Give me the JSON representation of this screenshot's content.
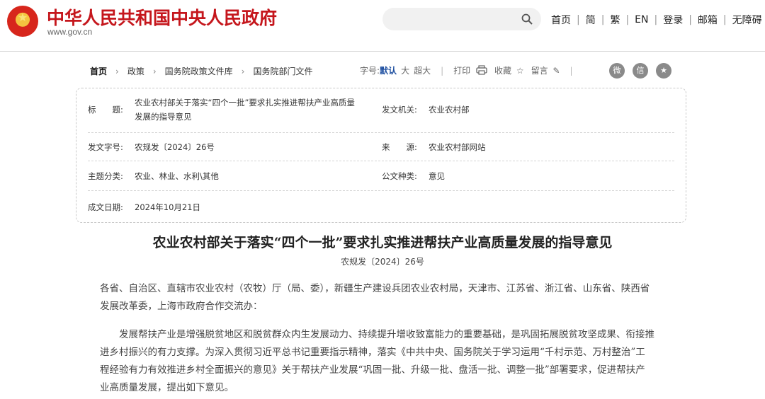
{
  "header": {
    "site_title": "中华人民共和国中央人民政府",
    "site_url": "www.gov.cn",
    "search_placeholder": "",
    "nav": [
      "首页",
      "简",
      "繁",
      "EN",
      "登录",
      "邮箱",
      "无障碍"
    ]
  },
  "breadcrumb": [
    "首页",
    "政策",
    "国务院政策文件库",
    "国务院部门文件"
  ],
  "toolbar": {
    "font_label": "字号:",
    "font_default": "默认",
    "font_large": "大",
    "font_xlarge": "超大",
    "print": "打印",
    "favorite": "收藏",
    "comment": "留言"
  },
  "meta": {
    "title_key": "标　　题:",
    "title_val_1": "农业农村部关于落实“四个一批”要求扎实推进帮扶产业高质量",
    "title_val_2": "发展的指导意见",
    "issuer_key": "发文机关:",
    "issuer_val": "农业农村部",
    "docno_key": "发文字号:",
    "docno_val": "农规发〔2024〕26号",
    "source_key": "来　　源:",
    "source_val": "农业农村部网站",
    "topic_key": "主题分类:",
    "topic_val": "农业、林业、水利\\其他",
    "type_key": "公文种类:",
    "type_val": "意见",
    "date_key": "成文日期:",
    "date_val": "2024年10月21日"
  },
  "article": {
    "title": "农业农村部关于落实“四个一批”要求扎实推进帮扶产业高质量发展的指导意见",
    "doc_number": "农规发〔2024〕26号",
    "para1_line1": "各省、自治区、直辖市农业农村（农牧）厅（局、委），新疆生产建设兵团农业农村局，天津市、江苏省、浙江省、山东省、陕西省",
    "para1_line2": "发展改革委，上海市政府合作交流办：",
    "para2_line1": "　　发展帮扶产业是增强脱贫地区和脱贫群众内生发展动力、持续提升增收致富能力的重要基础，是巩固拓展脱贫攻坚成果、衔接推",
    "para2_line2": "进乡村振兴的有力支撑。为深入贯彻习近平总书记重要指示精神，落实《中共中央、国务院关于学习运用“千村示范、万村整治”工",
    "para2_line3": "程经验有力有效推进乡村全面振兴的意见》关于帮扶产业发展“巩固一批、升级一批、盘活一批、调整一批”部署要求，促进帮扶产",
    "para2_line4": "业高质量发展，提出如下意见。"
  }
}
